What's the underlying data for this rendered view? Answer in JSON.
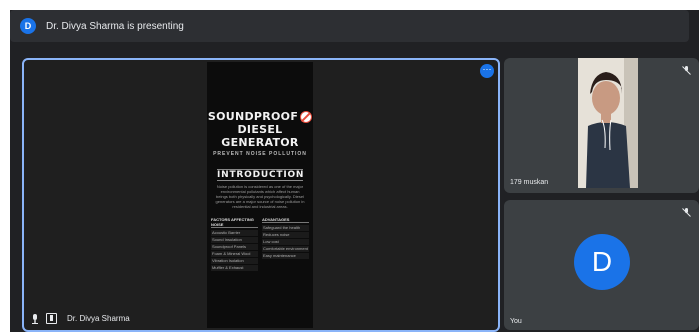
{
  "banner": {
    "avatar_letter": "D",
    "text": "Dr. Divya Sharma is presenting"
  },
  "main": {
    "slide": {
      "title_line1": "SOUNDPROOF",
      "title_line2": "DIESEL GENERATOR",
      "subtitle": "PREVENT NOISE POLLUTION",
      "heading": "INTRODUCTION",
      "body": "Noise pollution is considered as one of the major environmental pollutants which affect human beings both physically and psychologically. Diesel generators are a major source of noise pollution in residential and industrial areas.",
      "col1_header": "FACTORS AFFECTING NOISE",
      "col1_items": [
        "Acoustic Barrier",
        "Sound Insulation",
        "Soundproof Panels",
        "Foam & Mineral Wool",
        "Vibration Isolation",
        "Muffler & Exhaust"
      ],
      "col2_header": "ADVANTAGES",
      "col2_items": [
        "Safeguard the health",
        "Reduces noise",
        "Low cost",
        "Comfortable environment",
        "Easy maintenance"
      ]
    },
    "presenter_name": "Dr. Divya Sharma",
    "more_icon": "more-options-icon"
  },
  "participants": [
    {
      "name": "179 muskan"
    },
    {
      "name": "You",
      "avatar_letter": "D"
    }
  ],
  "colors": {
    "accent": "#1a73e8",
    "tile_border": "#8ab4f8",
    "background": "#202124"
  }
}
